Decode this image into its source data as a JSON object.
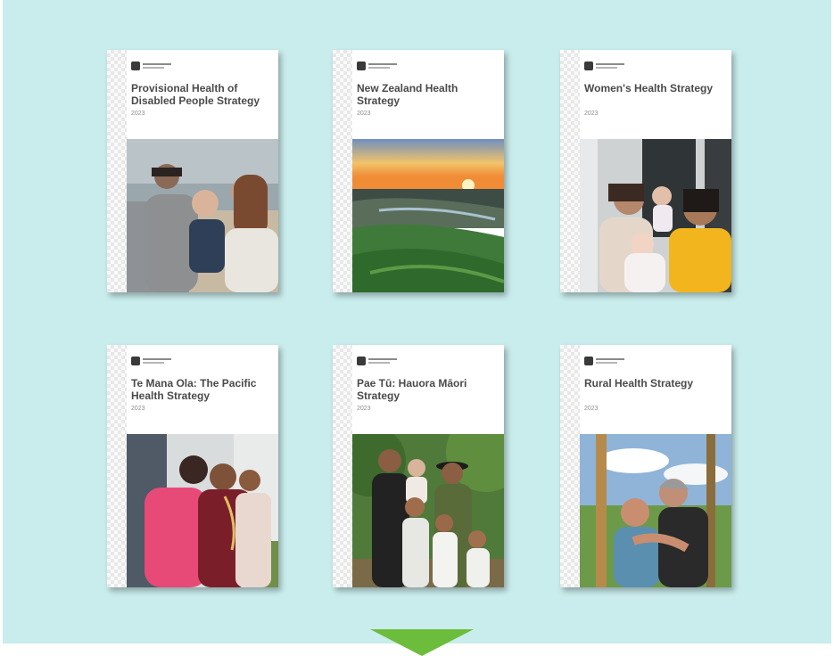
{
  "logo_label": "Te Kāwanatanga o Aotearoa",
  "colors": {
    "background": "#c9ecec",
    "arrow": "#6cbd3b",
    "title": "#4a4a4a"
  },
  "reports": [
    {
      "title": "Provisional Health of Disabled People Strategy",
      "year": "2023",
      "photo": "family with child by the sea"
    },
    {
      "title": "New Zealand Health Strategy",
      "year": "2023",
      "photo": "sunrise over green hills and river"
    },
    {
      "title": "Women's Health Strategy",
      "year": "2023",
      "photo": "women with baby and toddler"
    },
    {
      "title": "Te Mana Ola: The Pacific Health Strategy",
      "year": "2023",
      "photo": "Pacific family embracing"
    },
    {
      "title": "Pae Tū: Hauora Māori Strategy",
      "year": "2023",
      "photo": "Māori family outdoors"
    },
    {
      "title": "Rural Health Strategy",
      "year": "2023",
      "photo": "rural couple on veranda"
    }
  ],
  "arrow_icon": "down-arrow-icon"
}
